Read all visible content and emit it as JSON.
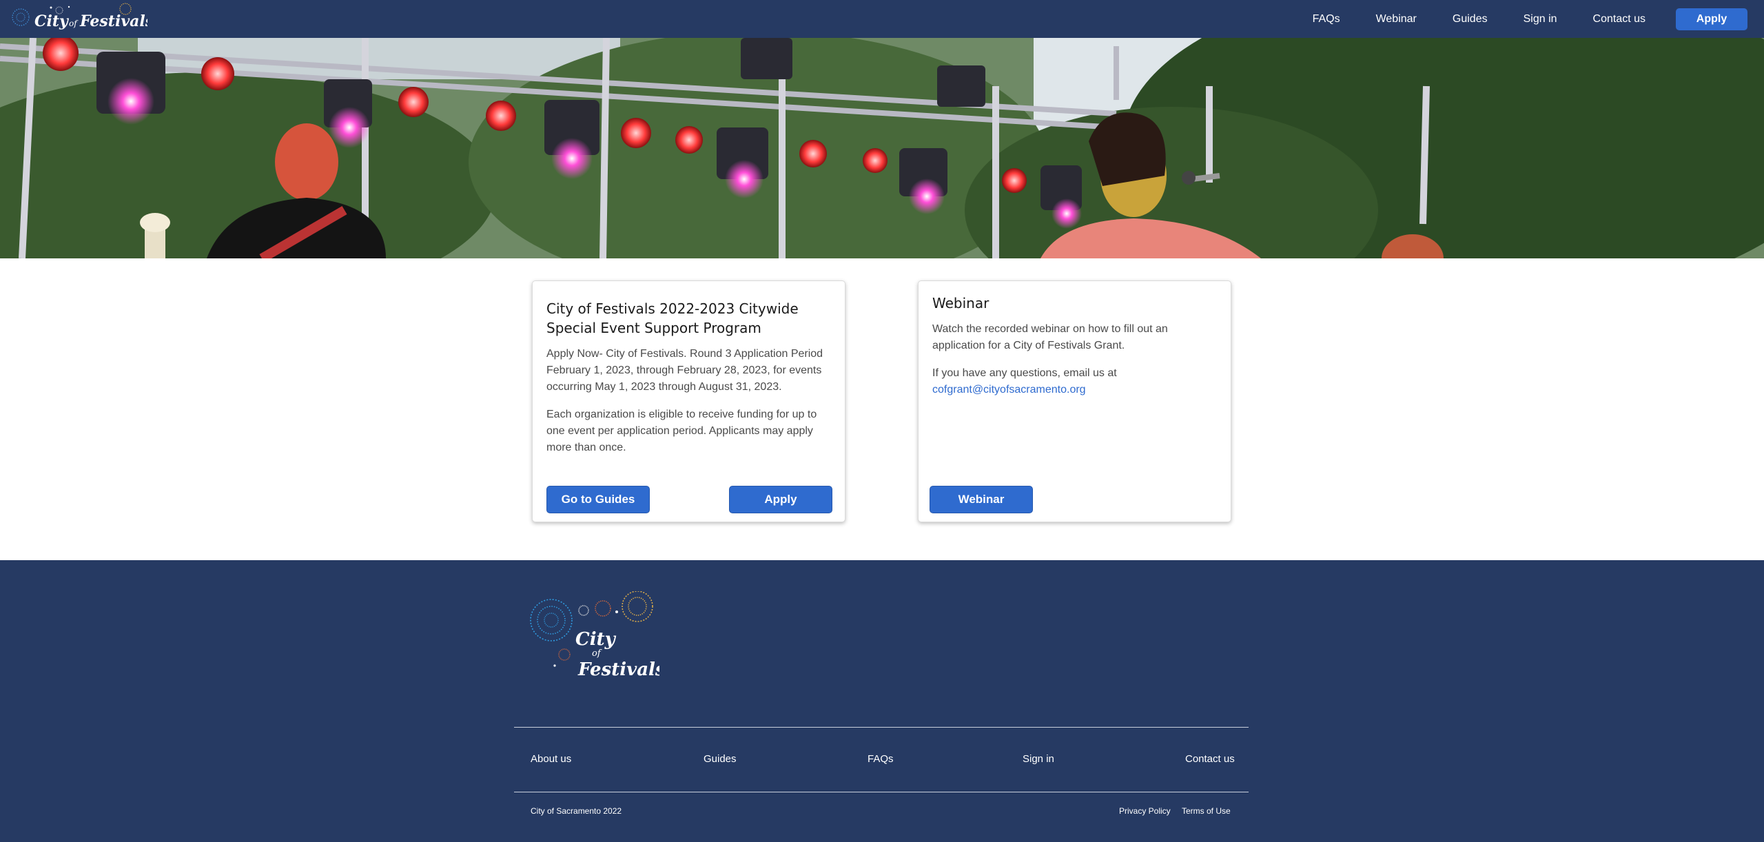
{
  "header": {
    "brand": "City of Festivals",
    "nav": [
      "FAQs",
      "Webinar",
      "Guides",
      "Sign in",
      "Contact us"
    ],
    "apply_label": "Apply"
  },
  "cards": {
    "program": {
      "title": "City of Festivals 2022-2023 Citywide Special Event Support Program",
      "para1": "Apply Now- City of Festivals. Round 3 Application Period February 1, 2023, through February 28, 2023, for events occurring May 1, 2023 through August 31, 2023.",
      "para2": "Each organization is eligible to receive funding for up to one event per application period. Applicants may apply more than once.",
      "guides_button": "Go to Guides",
      "apply_button": "Apply"
    },
    "webinar": {
      "title": "Webinar",
      "para1": "Watch the recorded webinar on how to fill out an application for a City of Festivals Grant.",
      "para2_prefix": "If you have any questions, email us at",
      "email": "cofgrant@cityofsacramento.org",
      "button": "Webinar"
    }
  },
  "footer": {
    "brand": "City of Festivals",
    "links": [
      "About us",
      "Guides",
      "FAQs",
      "Sign in",
      "Contact us"
    ],
    "copyright": "City of Sacramento 2022",
    "privacy": "Privacy Policy",
    "terms": "Terms of Use"
  },
  "colors": {
    "navy": "#263a63",
    "accent_blue": "#2f6bcf"
  }
}
